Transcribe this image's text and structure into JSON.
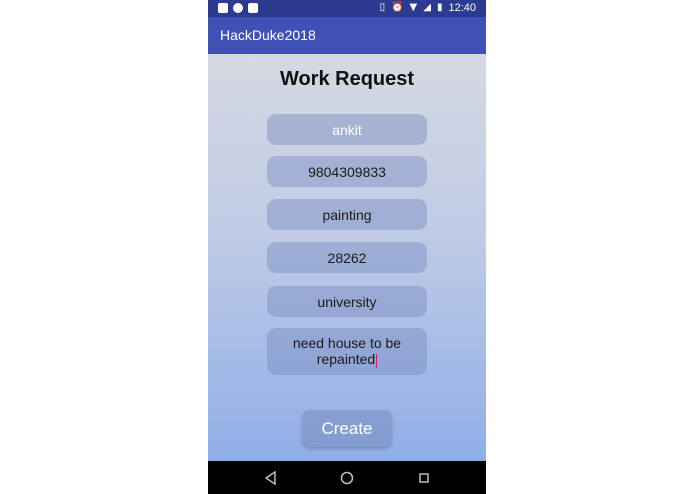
{
  "status_bar": {
    "left_icons": [
      "facebook-icon",
      "chat-icon",
      "image-icon"
    ],
    "right_icons": [
      "vibrate-icon",
      "alarm-icon",
      "wifi-icon",
      "signal-icon",
      "battery-icon"
    ],
    "time": "12:40"
  },
  "app_bar": {
    "title": "HackDuke2018"
  },
  "form": {
    "title": "Work Request",
    "fields": [
      {
        "value": "ankit"
      },
      {
        "value": "9804309833"
      },
      {
        "value": "painting"
      },
      {
        "value": "28262"
      },
      {
        "value": "university"
      },
      {
        "value": "need house to be repainted"
      }
    ],
    "create_label": "Create"
  },
  "nav_bar": {
    "icons": [
      "back-icon",
      "home-icon",
      "recents-icon"
    ]
  },
  "colors": {
    "status_bar": "#2c3a8f",
    "app_bar": "#3f51b5",
    "field_bg": "#94a6d2",
    "cursor": "#d81b60"
  }
}
